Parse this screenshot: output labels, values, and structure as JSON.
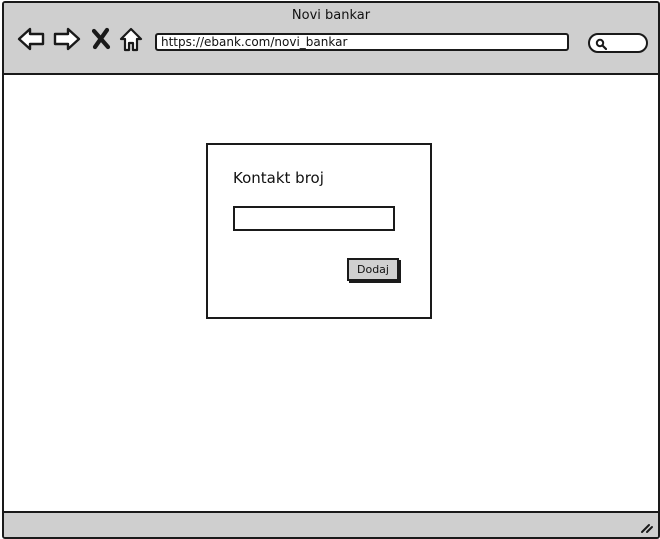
{
  "window": {
    "title": "Novi bankar"
  },
  "toolbar": {
    "icons": [
      "back-arrow-icon",
      "forward-arrow-icon",
      "close-icon",
      "home-icon"
    ],
    "address": "https://ebank.com/novi_bankar",
    "search_icon": "search-icon"
  },
  "dialog": {
    "label": "Kontakt broj",
    "input_value": "",
    "button_label": "Dodaj"
  },
  "statusbar": {
    "grip_icon": "resize-grip-icon"
  }
}
